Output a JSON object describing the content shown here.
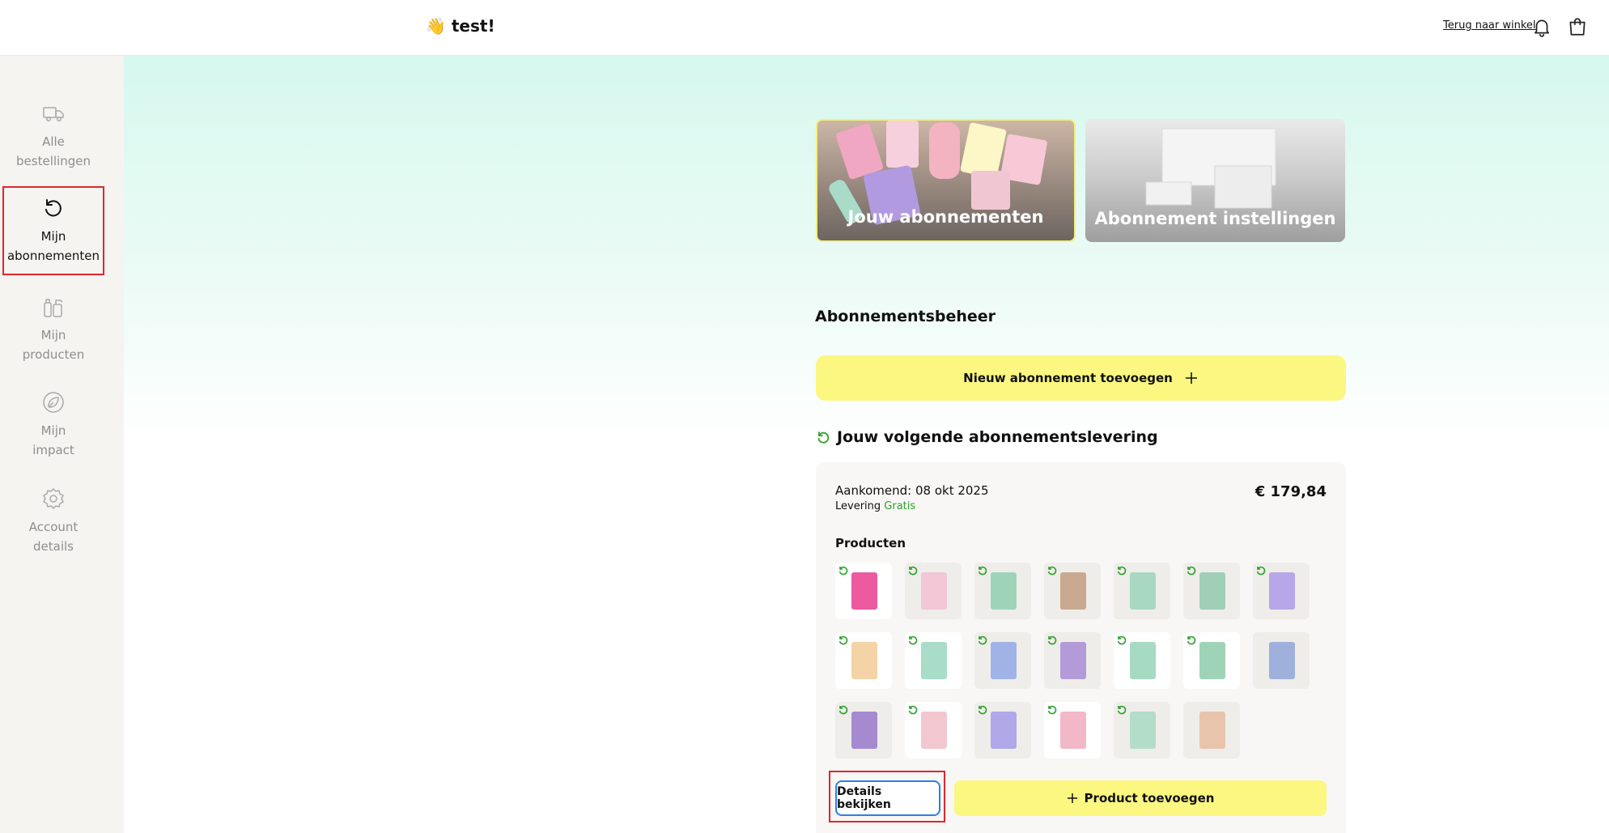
{
  "header": {
    "greeting": "👋 test!",
    "back_link": "Terug naar winkel",
    "bell_icon": "bell-icon",
    "cart_icon": "shopping-bag-icon"
  },
  "sidebar": {
    "items": [
      {
        "label_line1": "Alle",
        "label_line2": "bestellingen",
        "icon": "delivery-truck-icon",
        "active": false
      },
      {
        "label_line1": "Mijn",
        "label_line2": "abonnementen",
        "icon": "refresh-icon",
        "active": true
      },
      {
        "label_line1": "Mijn",
        "label_line2": "producten",
        "icon": "cleaning-bottles-icon",
        "active": false
      },
      {
        "label_line1": "Mijn",
        "label_line2": "impact",
        "icon": "leaf-icon",
        "active": false
      },
      {
        "label_line1": "Account",
        "label_line2": "details",
        "icon": "gear-icon",
        "active": false
      }
    ]
  },
  "tiles": {
    "subscriptions": "Jouw abonnementen",
    "settings": "Abonnement instellingen"
  },
  "management": {
    "title": "Abonnementsbeheer",
    "add_subscription": "Nieuw abonnement toevoegen"
  },
  "next_delivery": {
    "title": "Jouw volgende abonnementslevering",
    "arrival": "Aankomend: 08 okt 2025",
    "delivery_label": "Levering",
    "delivery_value": "Gratis",
    "price": "€ 179,84",
    "products_title": "Producten",
    "details_button": "Details bekijken",
    "add_product_button": "Product toevoegen"
  },
  "products": [
    {
      "color": "#ec5aa0",
      "recurring": true,
      "white": true
    },
    {
      "color": "#f2c6d4",
      "recurring": true,
      "white": false
    },
    {
      "color": "#9fd3b8",
      "recurring": true,
      "white": false
    },
    {
      "color": "#c9a98f",
      "recurring": true,
      "white": false
    },
    {
      "color": "#a8d8c2",
      "recurring": true,
      "white": false
    },
    {
      "color": "#9fcfb6",
      "recurring": true,
      "white": false
    },
    {
      "color": "#b7a6e8",
      "recurring": true,
      "white": false
    },
    {
      "color": "#f4d3a6",
      "recurring": true,
      "white": true
    },
    {
      "color": "#a9dcc9",
      "recurring": true,
      "white": true
    },
    {
      "color": "#9fb3e6",
      "recurring": true,
      "white": false
    },
    {
      "color": "#b39ad8",
      "recurring": true,
      "white": false
    },
    {
      "color": "#a7dac3",
      "recurring": true,
      "white": true
    },
    {
      "color": "#9fd3b8",
      "recurring": true,
      "white": true
    },
    {
      "color": "#9fb0dc",
      "recurring": false,
      "white": false
    },
    {
      "color": "#a58ad0",
      "recurring": true,
      "white": false
    },
    {
      "color": "#f3c7cf",
      "recurring": true,
      "white": true
    },
    {
      "color": "#b0a8e8",
      "recurring": true,
      "white": false
    },
    {
      "color": "#f2b8c8",
      "recurring": true,
      "white": true
    },
    {
      "color": "#b3ddc9",
      "recurring": true,
      "white": false
    },
    {
      "color": "#e8c4ac",
      "recurring": false,
      "white": false
    }
  ]
}
